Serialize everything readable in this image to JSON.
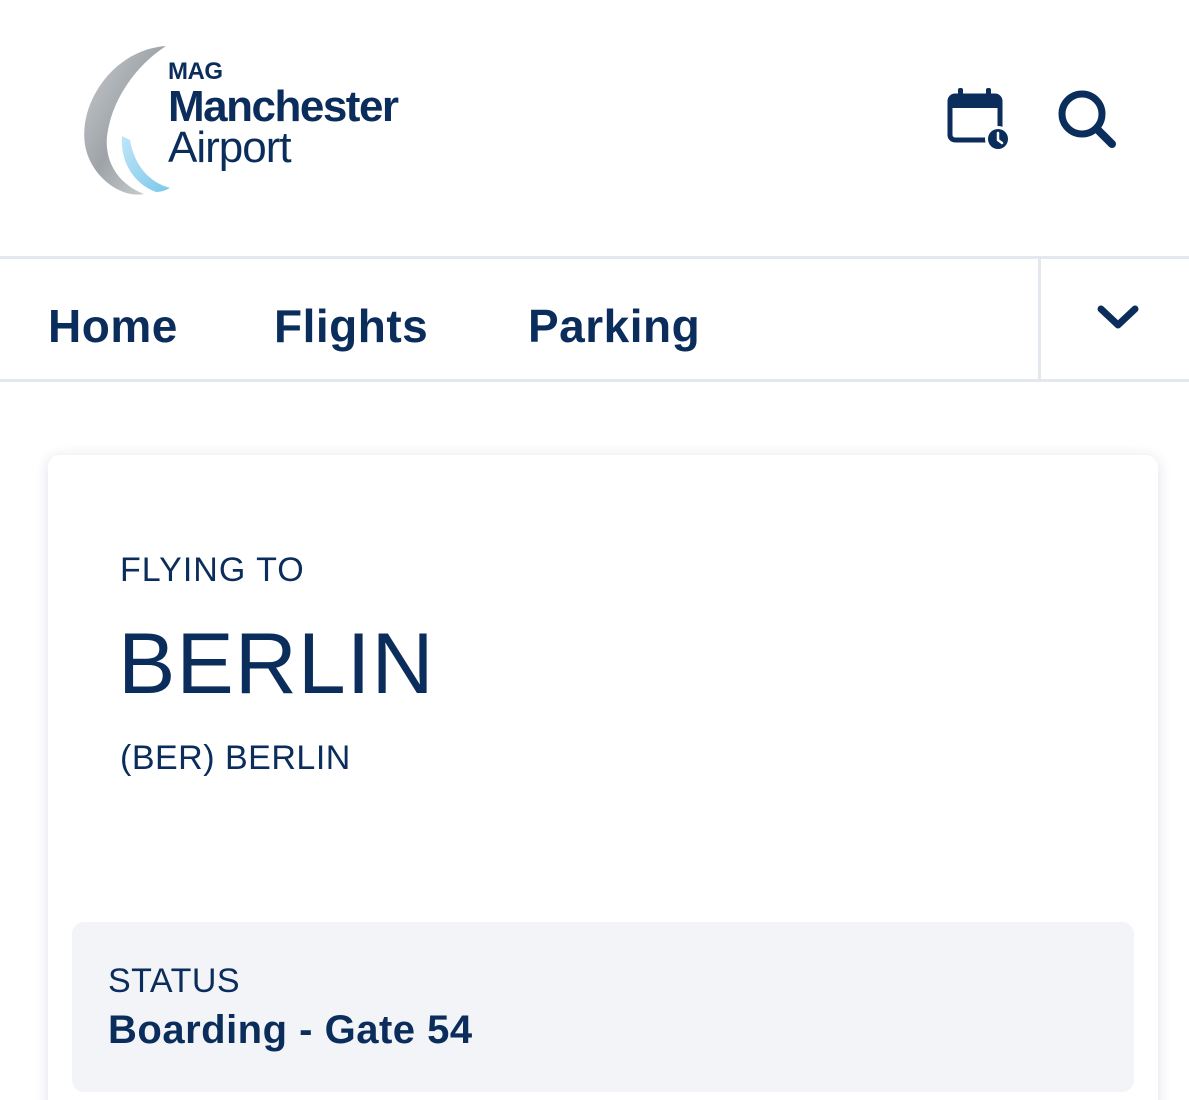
{
  "header": {
    "logo": {
      "mag": "MAG",
      "name_line1": "Manchester",
      "name_line2": "Airport"
    },
    "icons": [
      "calendar-clock-icon",
      "search-icon"
    ]
  },
  "nav": {
    "items": [
      {
        "label": "Home"
      },
      {
        "label": "Flights"
      },
      {
        "label": "Parking"
      }
    ],
    "more_icon": "chevron-down-icon"
  },
  "flight": {
    "flying_to_label": "FLYING TO",
    "destination_city": "BERLIN",
    "destination_airport": "(BER) BERLIN",
    "status_label": "STATUS",
    "status_value": "Boarding - Gate 54"
  },
  "colors": {
    "brand_navy": "#0b2d5b",
    "divider": "#e3e8ef",
    "status_bg": "#f2f4f7",
    "logo_silver": "#a6abb0",
    "logo_blue": "#8fd0ee"
  }
}
